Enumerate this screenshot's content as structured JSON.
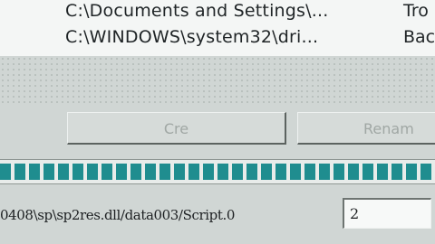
{
  "file_list": {
    "rows": [
      {
        "path": "C:\\Documents and Settings\\...",
        "type": "Tro"
      },
      {
        "path": "C:\\WINDOWS\\system32\\dri...",
        "type": "Bac"
      }
    ]
  },
  "buttons": {
    "create_label": "Cre",
    "rename_label": "Renam"
  },
  "progress": {
    "value_fraction": 1.0,
    "color": "#1f8d8f"
  },
  "status": {
    "current_path": "0408\\sp\\sp2res.dll/data003/Script.0",
    "count_value": "2"
  }
}
